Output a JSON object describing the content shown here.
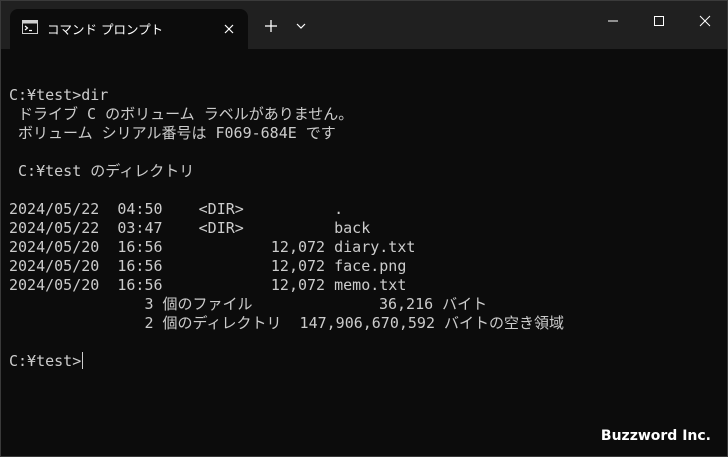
{
  "window": {
    "tab_title": "コマンド プロンプト",
    "new_tab_label": "+",
    "icons": {
      "tab": "console-icon",
      "close_tab": "close-icon",
      "dropdown": "chevron-down-icon",
      "minimize": "minimize-icon",
      "maximize": "maximize-icon",
      "close": "close-icon"
    }
  },
  "console": {
    "lines": [
      "",
      "C:¥test>dir",
      " ドライブ C のボリューム ラベルがありません。",
      " ボリューム シリアル番号は F069-684E です",
      "",
      " C:¥test のディレクトリ",
      "",
      "2024/05/22  04:50    <DIR>          .",
      "2024/05/22  03:47    <DIR>          back",
      "2024/05/20  16:56            12,072 diary.txt",
      "2024/05/20  16:56            12,072 face.png",
      "2024/05/20  16:56            12,072 memo.txt",
      "               3 個のファイル              36,216 バイト",
      "               2 個のディレクトリ  147,906,670,592 バイトの空き領域",
      "",
      "C:¥test>"
    ]
  },
  "watermark": "Buzzword Inc."
}
